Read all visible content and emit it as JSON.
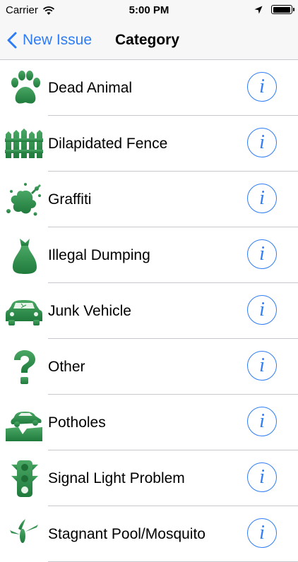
{
  "status_bar": {
    "carrier": "Carrier",
    "time": "5:00 PM"
  },
  "nav": {
    "back_label": "New Issue",
    "title": "Category"
  },
  "colors": {
    "accent": "#2d7cf6",
    "icon_green": "#2e8b4a"
  },
  "info_glyph": "i",
  "categories": [
    {
      "label": "Dead Animal",
      "icon": "paw-icon"
    },
    {
      "label": "Dilapidated Fence",
      "icon": "fence-icon"
    },
    {
      "label": "Graffiti",
      "icon": "paint-splat-icon"
    },
    {
      "label": "Illegal Dumping",
      "icon": "trash-bag-icon"
    },
    {
      "label": "Junk Vehicle",
      "icon": "wrecked-car-icon"
    },
    {
      "label": "Other",
      "icon": "question-mark-icon"
    },
    {
      "label": "Potholes",
      "icon": "pothole-icon"
    },
    {
      "label": "Signal Light Problem",
      "icon": "traffic-light-icon"
    },
    {
      "label": "Stagnant Pool/Mosquito",
      "icon": "mosquito-icon"
    }
  ]
}
